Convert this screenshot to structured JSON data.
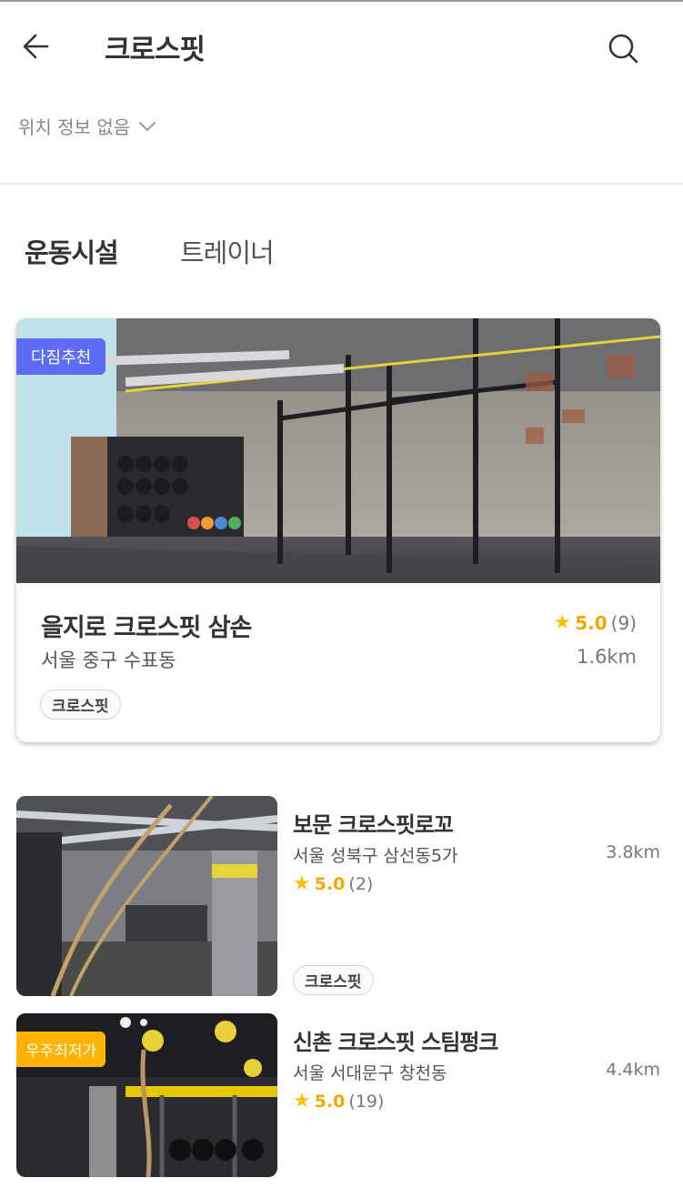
{
  "header": {
    "title": "크로스핏",
    "back_icon": "arrow-left-icon",
    "search_icon": "search-icon"
  },
  "location": {
    "label": "위치 정보 없음",
    "icon": "chevron-down-icon"
  },
  "tabs": [
    {
      "label": "운동시설",
      "active": true
    },
    {
      "label": "트레이너",
      "active": false
    }
  ],
  "featured": {
    "badge": "다짐추천",
    "name": "을지로 크로스핏 삼손",
    "address": "서울 중구 수표동",
    "rating": "5.0",
    "review_count": "(9)",
    "distance": "1.6km",
    "tag": "크로스핏"
  },
  "items": [
    {
      "name": "보문 크로스핏로꼬",
      "address": "서울 성북구 삼선동5가",
      "distance": "3.8km",
      "rating": "5.0",
      "review_count": "(2)",
      "tag": "크로스핏",
      "badge": ""
    },
    {
      "name": "신촌 크로스핏 스팀펑크",
      "address": "서울 서대문구 창천동",
      "distance": "4.4km",
      "rating": "5.0",
      "review_count": "(19)",
      "tag": "",
      "badge": "우주최저가"
    }
  ],
  "colors": {
    "accent_blue": "#5c6cf5",
    "star": "#ffc107",
    "badge_orange": "#ffb300"
  }
}
